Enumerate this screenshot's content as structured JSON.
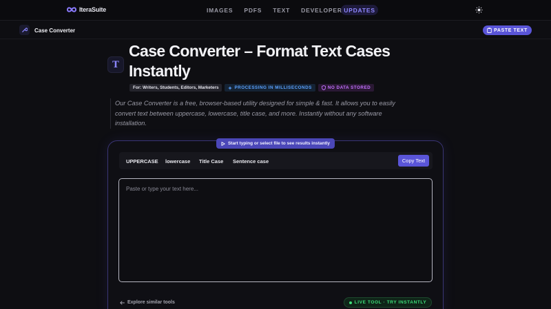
{
  "brand": {
    "name": "IteraSuite",
    "accent": "#8b7bff"
  },
  "nav": {
    "links": [
      "IMAGES",
      "PDFS",
      "TEXT",
      "DEVELOPERS"
    ],
    "updates_label": "UPDATES"
  },
  "subbar": {
    "tool_name": "Case Converter",
    "paste_label": "PASTE TEXT"
  },
  "hero": {
    "icon_glyph": "T",
    "title": "Case Converter – Format Text Cases Instantly",
    "tags": {
      "audience": "For: Writers, Students, Editors, Marketers",
      "speed": "PROCESSING IN MILLISECONDS",
      "privacy": "NO DATA STORED"
    },
    "description": "Our Case Converter is a free, browser-based utility designed for simple & fast. It allows you to easily convert text between uppercase, lowercase, title case, and more. Instantly without any software installation."
  },
  "tool": {
    "hint": "Start typing or select file to see results instantly",
    "case_buttons": [
      "UPPERCASE",
      "lowercase",
      "Title Case",
      "Sentence case"
    ],
    "copy_label": "Copy Text",
    "input_placeholder": "Paste or type your text here...",
    "input_value": ""
  },
  "footer": {
    "explore_label": "Explore similar tools",
    "live_label": "LIVE TOOL · TRY INSTANTLY"
  },
  "colors": {
    "primary": "#5a55d8",
    "speed": "#5aa2ff",
    "privacy": "#c471ff",
    "live": "#3ee07a"
  }
}
